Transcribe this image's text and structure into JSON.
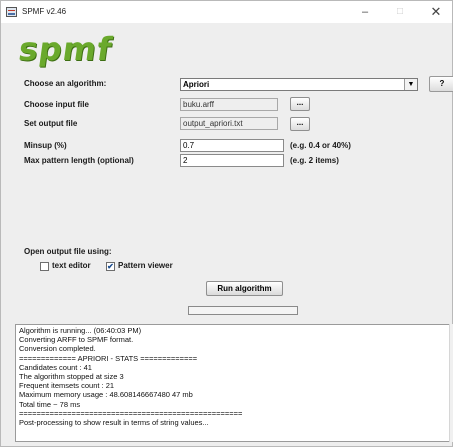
{
  "window": {
    "title": "SPMF v2.46",
    "minimize": "–",
    "maximize": "□",
    "close": "✕"
  },
  "logo": {
    "text": "spmf"
  },
  "form": {
    "algorithm": {
      "label": "Choose an algorithm:",
      "value": "Apriori",
      "help": "?"
    },
    "input_file": {
      "label": "Choose input file",
      "value": "buku.arff",
      "browse": "..."
    },
    "output_file": {
      "label": "Set output file",
      "value": "output_apriori.txt",
      "browse": "..."
    },
    "minsup": {
      "label": "Minsup (%)",
      "value": "0.7",
      "hint": "(e.g. 0.4 or 40%)"
    },
    "max_length": {
      "label": "Max pattern length (optional)",
      "value": "2",
      "hint": "(e.g. 2 items)"
    }
  },
  "open_output": {
    "label": "Open output file using:",
    "text_editor": {
      "label": "text editor",
      "checked": false
    },
    "pattern_viewer": {
      "label": "Pattern viewer",
      "checked": true
    }
  },
  "run_button": "Run algorithm",
  "progress": {
    "fraction": 0
  },
  "console": {
    "lines": [
      "Algorithm is running... (06:40:03 PM)",
      "Converting ARFF to SPMF format.",
      "Conversion completed.",
      "============= APRIORI - STATS =============",
      " Candidates count : 41",
      " The algorithm stopped at size 3",
      " Frequent itemsets count : 21",
      " Maximum memory usage : 48.608146667480 47 mb",
      " Total time ~ 78 ms",
      "===================================================",
      "Post-processing to show result in terms of string values..."
    ]
  },
  "colors": {
    "logo_green": "#6aa92c",
    "progress_fill": "#6b9bd2",
    "check_mark": "#1a4c8f"
  }
}
